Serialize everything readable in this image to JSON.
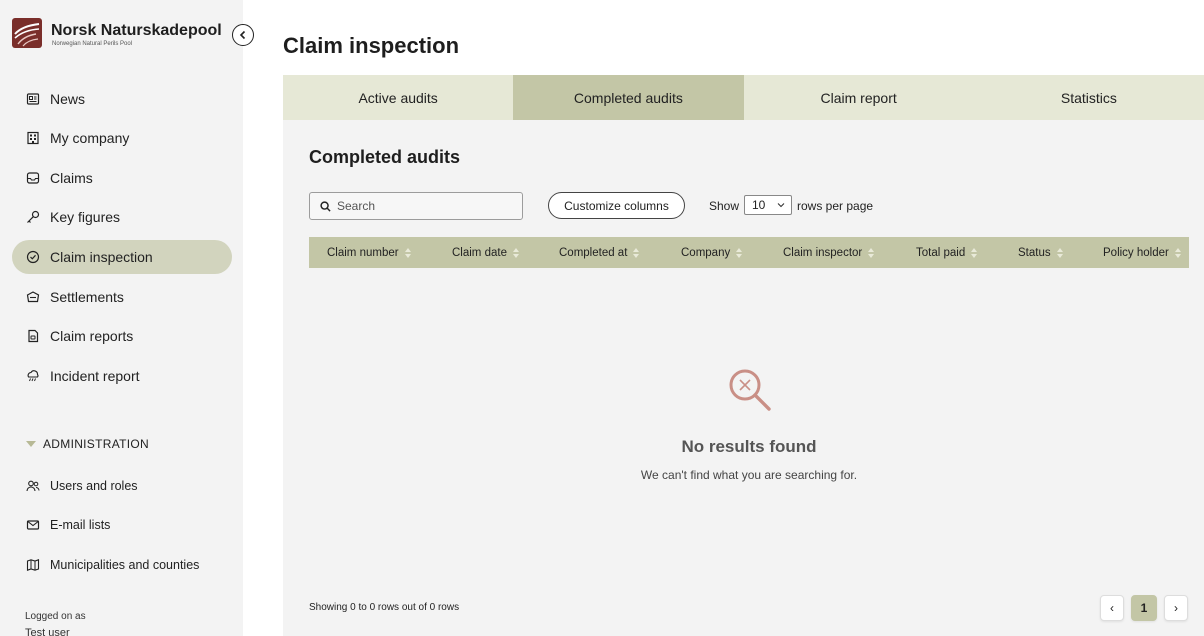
{
  "brand": {
    "name": "Norsk Naturskadepool",
    "subtitle": "Norwegian Natural Perils Pool"
  },
  "sidebar": {
    "items": [
      {
        "label": "News",
        "icon": "newspaper-icon"
      },
      {
        "label": "My company",
        "icon": "building-icon"
      },
      {
        "label": "Claims",
        "icon": "inbox-icon"
      },
      {
        "label": "Key figures",
        "icon": "key-icon"
      },
      {
        "label": "Claim inspection",
        "icon": "check-circle-icon",
        "active": true
      },
      {
        "label": "Settlements",
        "icon": "settlement-icon"
      },
      {
        "label": "Claim reports",
        "icon": "report-icon"
      },
      {
        "label": "Incident report",
        "icon": "cloud-rain-icon"
      }
    ],
    "admin_heading": "ADMINISTRATION",
    "admin_items": [
      {
        "label": "Users and roles",
        "icon": "users-icon"
      },
      {
        "label": "E-mail lists",
        "icon": "mail-icon"
      },
      {
        "label": "Municipalities and counties",
        "icon": "map-icon"
      }
    ],
    "logged_on_label": "Logged on as",
    "logged_user": "Test user"
  },
  "page": {
    "title": "Claim inspection"
  },
  "tabs": [
    {
      "label": "Active audits",
      "active": false
    },
    {
      "label": "Completed audits",
      "active": true
    },
    {
      "label": "Claim report",
      "active": false
    },
    {
      "label": "Statistics",
      "active": false
    }
  ],
  "section": {
    "title": "Completed audits"
  },
  "toolbar": {
    "search_placeholder": "Search",
    "customize_label": "Customize columns",
    "show_label": "Show",
    "rows_value": "10",
    "rows_label": "rows per page"
  },
  "table": {
    "columns": [
      "Claim number",
      "Claim date",
      "Completed at",
      "Company",
      "Claim inspector",
      "Total paid",
      "Status",
      "Policy holder"
    ]
  },
  "empty_state": {
    "title": "No results found",
    "subtitle": "We can't find what you are searching for."
  },
  "footer": {
    "showing": "Showing 0 to 0 rows out of 0 rows",
    "current_page": "1",
    "prev": "‹",
    "next": "›"
  },
  "colors": {
    "accent": "#c3c6a6",
    "active_nav": "#d2d4be",
    "tabs_bg": "#e6e8d6",
    "panel_bg": "#f3f3f3",
    "empty_icon": "#c98f86"
  }
}
